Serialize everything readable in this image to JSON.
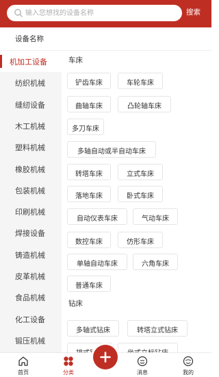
{
  "search": {
    "placeholder": "输入您想找的设备名称",
    "button_label": "搜索"
  },
  "section_title": "设备名称",
  "sidebar": {
    "items": [
      "机加工设备",
      "纺织机械",
      "缝纫设备",
      "木工机械",
      "塑料机械",
      "橡胶机械",
      "包装机械",
      "印刷机械",
      "焊接设备",
      "铸造机械",
      "皮革机械",
      "食品机械",
      "化工设备",
      "锻压机械"
    ],
    "active_index": 0
  },
  "categories": [
    {
      "title": "车床",
      "tags": [
        "铲齿车床",
        "车轮车床",
        "曲轴车床",
        "凸轮轴车床",
        "多刀车床",
        "多轴自动或半自动车床",
        "转塔车床",
        "立式车床",
        "落地车床",
        "卧式车床",
        "自动仪表车床",
        "气动车床",
        "数控车床",
        "仿形车床",
        "单轴自动车床",
        "六角车床",
        "普通车床"
      ]
    },
    {
      "title": "钻床",
      "tags": [
        "多轴式钻床",
        "转塔立式钻床",
        "排式钻床",
        "坐式立标钻床"
      ]
    }
  ],
  "tabbar": {
    "items": [
      {
        "label": "首页",
        "icon": "home-icon"
      },
      {
        "label": "分类",
        "icon": "category-icon"
      },
      {
        "label": "",
        "icon": "plus-icon"
      },
      {
        "label": "消息",
        "icon": "message-icon"
      },
      {
        "label": "我的",
        "icon": "profile-icon"
      }
    ],
    "active_index": 1
  },
  "colors": {
    "accent": "#bf2e23",
    "sidebar_bg": "#f5f5f5",
    "tag_border": "#e5e5e5"
  }
}
